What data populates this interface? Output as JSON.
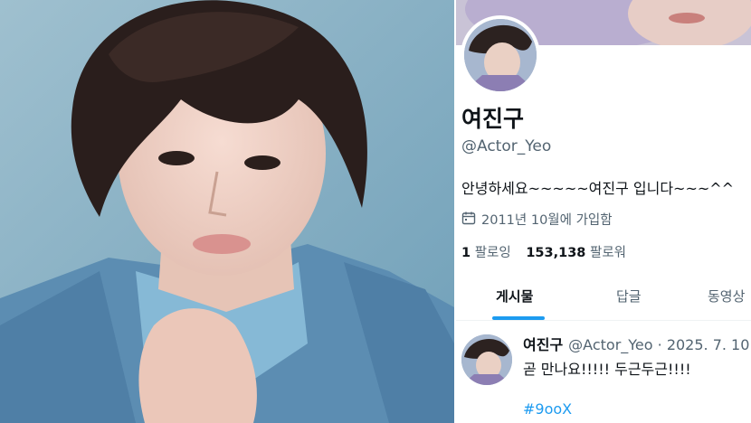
{
  "profile": {
    "name": "여진구",
    "handle": "@Actor_Yeo",
    "bio": "안녕하세요~~~~~여진구 입니다~~~^^",
    "joined": "2011년 10월에 가입함",
    "following_count": "1",
    "following_label": "팔로잉",
    "followers_count": "153,138",
    "followers_label": "팔로워"
  },
  "tabs": [
    {
      "label": "게시물",
      "active": true
    },
    {
      "label": "답글",
      "active": false
    },
    {
      "label": "동영상",
      "active": false
    }
  ],
  "tweet": {
    "author": "여진구",
    "meta": "@Actor_Yeo · 2025. 7. 10",
    "text": "곧 만나요!!!!! 두근두근!!!!",
    "hashtag": "#9ooX"
  },
  "colors": {
    "accent": "#1d9bf0",
    "text": "#0f1419",
    "muted": "#536471"
  },
  "icons": {
    "joined": "calendar-icon"
  }
}
